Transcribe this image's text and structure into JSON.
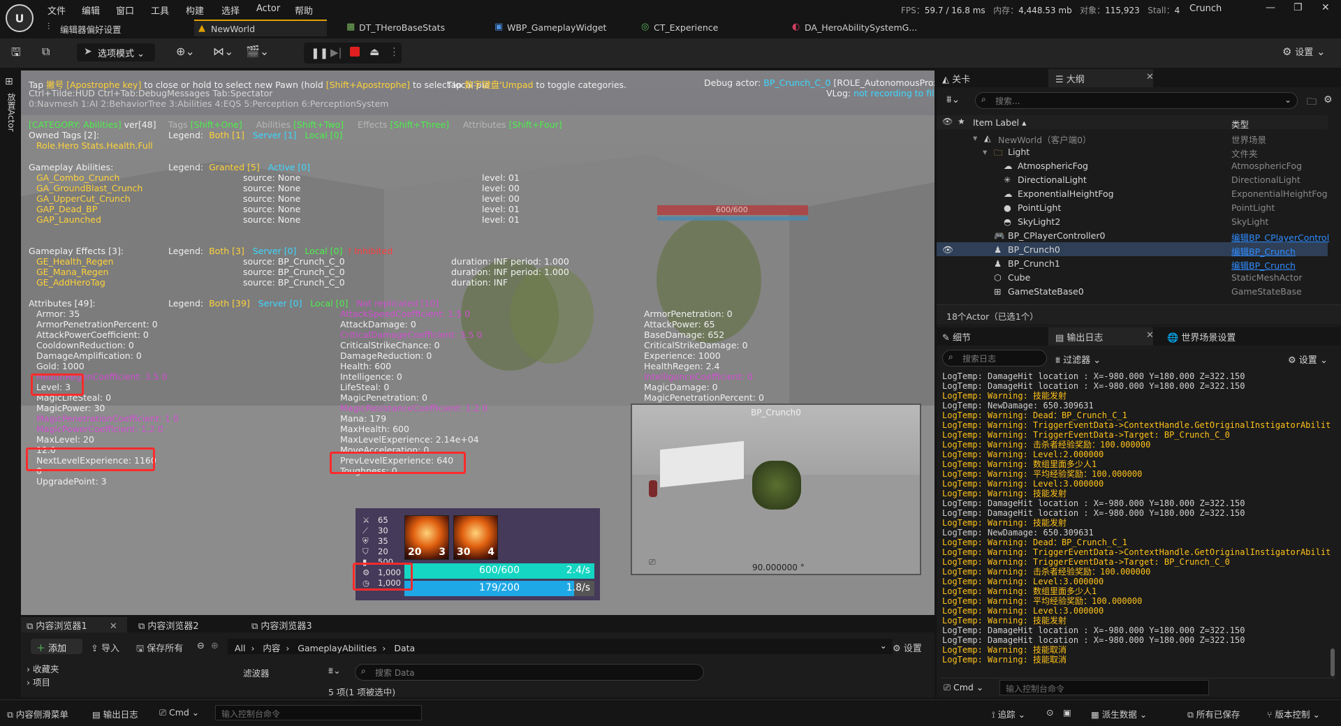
{
  "menu": {
    "items": [
      "文件",
      "编辑",
      "窗口",
      "工具",
      "构建",
      "选择",
      "Actor",
      "帮助"
    ],
    "stats": {
      "fps_label": "FPS：",
      "fps": "59.7",
      "ms": "/ 16.8 ms",
      "mem_label": "内存：",
      "mem": "4,448.53 mb",
      "obj_label": "对象：",
      "obj": "115,923",
      "stall_label": "Stall：",
      "stall": "4"
    },
    "project": "Crunch"
  },
  "tabs": [
    {
      "label": "编辑器偏好设置",
      "icon": "settings-sliders-icon"
    },
    {
      "label": "NewWorld",
      "icon": "level-icon"
    },
    {
      "label": "DT_THeroBaseStats",
      "icon": "datatable-icon"
    },
    {
      "label": "WBP_GameplayWidget",
      "icon": "widget-icon"
    },
    {
      "label": "CT_Experience",
      "icon": "curvetable-icon"
    },
    {
      "label": "DA_HeroAbilitySystemG...",
      "icon": "dataasset-icon"
    }
  ],
  "toolbar": {
    "mode_label": "选项模式",
    "settings_label": "设置"
  },
  "left_strip": {
    "label": "放置Actor"
  },
  "debug": {
    "line1_a": "Tap ",
    "line1_key": "撇号 [Apostrophe key]",
    "line1_b": " to close or hold to select new Pawn (hold ",
    "line1_key2": "[Shift+Apostrophe]",
    "line1_c": " to select local pla",
    "line1_d": "Tap ",
    "line1_key3": "数字键盘",
    "line1_e": "'Umpad",
    "line1_f": " to toggle categories.",
    "line2": "Ctrl+Tilde:HUD  Ctrl+Tab:DebugMessages  Tab:Spectator",
    "line3": "0:Navmesh  1:AI  2:BehaviorTree  3:Abilities  4:EQS  5:Perception  6:PerceptionSystem",
    "debug_actor_label": "Debug actor: ",
    "debug_actor": "BP_Crunch_C_0",
    "debug_role": " [ROLE_AutonomousProxy]",
    "vlog_label": "VLog: ",
    "vlog": "not recording to file",
    "category": "[CATEGORY: Abilities]",
    "ver": " ver[48]",
    "tags_label": "Tags ",
    "tags_key": "[Shift+One]",
    "abilities_label": "Abilities ",
    "abilities_key": "[Shift+Two]",
    "effects_label": "Effects ",
    "effects_key": "[Shift+Three]",
    "attributes_label": "Attributes ",
    "attributes_key": "[Shift+Four]",
    "owned_tags": "Owned Tags [2]:",
    "owned_tags_values": "Role.Hero Stats.Health.Full",
    "legend": "Legend:",
    "tags_legend_both": "Both [1]",
    "tags_legend_server": "Server [1]",
    "tags_legend_local": "Local [0]",
    "abilities_header": "Gameplay Abilities:",
    "abilities_legend_granted": "Granted [5]",
    "abilities_legend_active": "Active [0]",
    "abilities": [
      {
        "name": "GA_Combo_Crunch",
        "source": "source: None",
        "level": "level: 01"
      },
      {
        "name": "GA_GroundBlast_Crunch",
        "source": "source: None",
        "level": "level: 00"
      },
      {
        "name": "GA_UpperCut_Crunch",
        "source": "source: None",
        "level": "level: 00"
      },
      {
        "name": "GAP_Dead_BP",
        "source": "source: None",
        "level": "level: 01"
      },
      {
        "name": "GAP_Launched",
        "source": "source: None",
        "level": "level: 01"
      }
    ],
    "effects_header": "Gameplay Effects [3]:",
    "effects_legend_both": "Both [3]",
    "effects_legend_server": "Server [0]",
    "effects_legend_local": "Local [0]",
    "effects_legend_inhibited": "Inhibited",
    "effects": [
      {
        "name": "GE_Health_Regen",
        "source": "source: BP_Crunch_C_0",
        "duration": "duration: INF period: 1.000"
      },
      {
        "name": "GE_Mana_Regen",
        "source": "source: BP_Crunch_C_0",
        "duration": "duration: INF period: 1.000"
      },
      {
        "name": "GE_AddHeroTag",
        "source": "source: BP_Crunch_C_0",
        "duration": "duration: INF"
      }
    ],
    "attributes_header": "Attributes [49]:",
    "attr_legend_both": "Both [39]",
    "attr_legend_server": "Server [0]",
    "attr_legend_local": "Local [0]",
    "attr_legend_extra": "Not replicated [10]",
    "attr_col1": [
      {
        "t": "Armor: 35",
        "c": "w"
      },
      {
        "t": "ArmorPenetrationPercent: 0",
        "c": "w"
      },
      {
        "t": "AttackPowerCoefficient: 0",
        "c": "w"
      },
      {
        "t": "CooldownReduction: 0",
        "c": "w"
      },
      {
        "t": "DamageAmplification: 0",
        "c": "w"
      },
      {
        "t": "Gold: 1000",
        "c": "w"
      },
      {
        "t": "HealthRegenCoefficient: 3.5 0",
        "c": "m"
      },
      {
        "t": "Level: 3",
        "c": "w"
      },
      {
        "t": "MagicLifeSteal: 0",
        "c": "w"
      },
      {
        "t": "MagicPower: 30",
        "c": "w"
      },
      {
        "t": "MagicPenetrationCoefficient: 1 0",
        "c": "m"
      },
      {
        "t": "MagicPowerCoefficient: 1.2 0",
        "c": "m"
      },
      {
        "t": "MaxLevel: 20",
        "c": "w"
      },
      {
        "t": "12.0",
        "c": "w"
      },
      {
        "t": "NextLevelExperience: 1160",
        "c": "w"
      },
      {
        "t": "0",
        "c": "w"
      },
      {
        "t": "UpgradePoint: 3",
        "c": "w"
      }
    ],
    "attr_col2": [
      {
        "t": "AttackSpeedCoefficient: 1.5 0",
        "c": "m"
      },
      {
        "t": "AttackDamage: 0",
        "c": "w"
      },
      {
        "t": "CriticalDamageCoefficient: 3.5 0",
        "c": "m"
      },
      {
        "t": "CriticalStrikeChance: 0",
        "c": "w"
      },
      {
        "t": "DamageReduction: 0",
        "c": "w"
      },
      {
        "t": "Health: 600",
        "c": "w"
      },
      {
        "t": "Intelligence: 0",
        "c": "w"
      },
      {
        "t": "LifeSteal: 0",
        "c": "w"
      },
      {
        "t": "MagicPenetration: 0",
        "c": "w"
      },
      {
        "t": "MagicResistanceCoefficient: 1.2 0",
        "c": "m"
      },
      {
        "t": "Mana: 179",
        "c": "w"
      },
      {
        "t": "MaxHealth: 600",
        "c": "w"
      },
      {
        "t": "MaxLevelExperience: 2.14e+04",
        "c": "w"
      },
      {
        "t": "MoveAcceleration: 0",
        "c": "w"
      },
      {
        "t": "PrevLevelExperience: 640",
        "c": "w"
      },
      {
        "t": "Toughness: 0",
        "c": "w"
      }
    ],
    "attr_col3": [
      {
        "t": "ArmorPenetration: 0",
        "c": "w"
      },
      {
        "t": "AttackPower: 65",
        "c": "w"
      },
      {
        "t": "BaseDamage: 652",
        "c": "w"
      },
      {
        "t": "CriticalStrikeDamage: 0",
        "c": "w"
      },
      {
        "t": "Experience: 1000",
        "c": "w"
      },
      {
        "t": "HealthRegen: 2.4",
        "c": "w"
      },
      {
        "t": "IntelligenceCoefficient: 0",
        "c": "m"
      },
      {
        "t": "MagicDamage: 0",
        "c": "w"
      },
      {
        "t": "MagicPenetrationPercent: 0",
        "c": "w"
      }
    ],
    "enemy_health": "600/600"
  },
  "hud": {
    "stats": [
      "65",
      "30",
      "35",
      "20",
      "500",
      "1,000",
      "1,000"
    ],
    "skill1": {
      "level": "20",
      "count": "3"
    },
    "skill2": {
      "level": "30",
      "count": "4"
    },
    "health": {
      "text": "600/600",
      "regen": "2.4/s",
      "fraction": 1.0
    },
    "mana": {
      "text": "179/200",
      "regen": "1.8/s",
      "fraction": 0.895
    }
  },
  "preview": {
    "title": "BP_Crunch0",
    "angle": "90.000000 °"
  },
  "outliner": {
    "tabs": [
      "关卡",
      "大纲"
    ],
    "search_placeholder": "搜索...",
    "col_label": "Item Label ▴",
    "col_type": "类型",
    "rows": [
      {
        "label": "NewWorld（客户端0）",
        "type": "世界场景",
        "indent": 0,
        "icon": "level-icon",
        "link": false,
        "sel": false,
        "dim": true
      },
      {
        "label": "Light",
        "type": "文件夹",
        "indent": 1,
        "icon": "folder-icon",
        "link": false,
        "sel": false,
        "dim": false
      },
      {
        "label": "AtmosphericFog",
        "type": "AtmosphericFog",
        "indent": 2,
        "icon": "fog-icon",
        "link": false,
        "sel": false,
        "dim": false
      },
      {
        "label": "DirectionalLight",
        "type": "DirectionalLight",
        "indent": 2,
        "icon": "sun-icon",
        "link": false,
        "sel": false,
        "dim": false
      },
      {
        "label": "ExponentialHeightFog",
        "type": "ExponentialHeightFog",
        "indent": 2,
        "icon": "fog-icon",
        "link": false,
        "sel": false,
        "dim": false
      },
      {
        "label": "PointLight",
        "type": "PointLight",
        "indent": 2,
        "icon": "bulb-icon",
        "link": false,
        "sel": false,
        "dim": false
      },
      {
        "label": "SkyLight2",
        "type": "SkyLight",
        "indent": 2,
        "icon": "skylight-icon",
        "link": false,
        "sel": false,
        "dim": false
      },
      {
        "label": "BP_CPlayerController0",
        "type": "编辑BP_CPlayerControl",
        "indent": 1,
        "icon": "gamepad-icon",
        "link": true,
        "sel": false,
        "dim": false
      },
      {
        "label": "BP_Crunch0",
        "type": "编辑BP_Crunch",
        "indent": 1,
        "icon": "pawn-icon",
        "link": true,
        "sel": true,
        "dim": false
      },
      {
        "label": "BP_Crunch1",
        "type": "编辑BP_Crunch",
        "indent": 1,
        "icon": "pawn-icon",
        "link": true,
        "sel": false,
        "dim": false
      },
      {
        "label": "Cube",
        "type": "StaticMeshActor",
        "indent": 1,
        "icon": "cube-icon",
        "link": false,
        "sel": false,
        "dim": false
      },
      {
        "label": "GameStateBase0",
        "type": "GameStateBase",
        "indent": 1,
        "icon": "gamestate-icon",
        "link": false,
        "sel": false,
        "dim": false
      }
    ],
    "footer": "18个Actor（已选1个）"
  },
  "lower_right": {
    "tabs": [
      "细节",
      "输出日志",
      "世界场景设置"
    ],
    "search_placeholder": "搜索日志",
    "filter_label": "过滤器",
    "settings_label": "设置",
    "cmd_label": "Cmd",
    "console_placeholder": "输入控制台命令"
  },
  "log": [
    {
      "t": "LogTemp: DamageHit location : X=-980.000 Y=180.000 Z=322.150",
      "warn": false
    },
    {
      "t": "LogTemp: DamageHit location : X=-980.000 Y=180.000 Z=322.150",
      "warn": false
    },
    {
      "t": "LogTemp: Warning: 技能发射",
      "warn": true
    },
    {
      "t": "LogTemp: NewDamage: 650.309631",
      "warn": false
    },
    {
      "t": "LogTemp: Warning: Dead：BP_Crunch_C_1",
      "warn": true
    },
    {
      "t": "LogTemp: Warning: TriggerEventData->ContextHandle.GetOriginalInstigatorAbilit",
      "warn": true
    },
    {
      "t": "LogTemp: Warning: TriggerEventData->Target: BP_Crunch_C_0",
      "warn": true
    },
    {
      "t": "LogTemp: Warning: 击杀者经验奖励：100.000000",
      "warn": true
    },
    {
      "t": "LogTemp: Warning: Level:2.000000",
      "warn": true
    },
    {
      "t": "LogTemp: Warning: 数组里面多少人1",
      "warn": true
    },
    {
      "t": "LogTemp: Warning: 平均经验奖励：100.000000",
      "warn": true
    },
    {
      "t": "LogTemp: Warning: Level:3.000000",
      "warn": true
    },
    {
      "t": "LogTemp: Warning: 技能发射",
      "warn": true
    },
    {
      "t": "LogTemp: DamageHit location : X=-980.000 Y=180.000 Z=322.150",
      "warn": false
    },
    {
      "t": "LogTemp: DamageHit location : X=-980.000 Y=180.000 Z=322.150",
      "warn": false
    },
    {
      "t": "LogTemp: Warning: 技能发射",
      "warn": true
    },
    {
      "t": "LogTemp: NewDamage: 650.309631",
      "warn": false
    },
    {
      "t": "LogTemp: Warning: Dead：BP_Crunch_C_1",
      "warn": true
    },
    {
      "t": "LogTemp: Warning: TriggerEventData->ContextHandle.GetOriginalInstigatorAbilit",
      "warn": true
    },
    {
      "t": "LogTemp: Warning: TriggerEventData->Target: BP_Crunch_C_0",
      "warn": true
    },
    {
      "t": "LogTemp: Warning: 击杀者经验奖励：100.000000",
      "warn": true
    },
    {
      "t": "LogTemp: Warning: Level:3.000000",
      "warn": true
    },
    {
      "t": "LogTemp: Warning: 数组里面多少人1",
      "warn": true
    },
    {
      "t": "LogTemp: Warning: 平均经验奖励：100.000000",
      "warn": true
    },
    {
      "t": "LogTemp: Warning: Level:3.000000",
      "warn": true
    },
    {
      "t": "LogTemp: Warning: 技能发射",
      "warn": true
    },
    {
      "t": "LogTemp: DamageHit location : X=-980.000 Y=180.000 Z=322.150",
      "warn": false
    },
    {
      "t": "LogTemp: DamageHit location : X=-980.000 Y=180.000 Z=322.150",
      "warn": false
    },
    {
      "t": "LogTemp: Warning: 技能取消",
      "warn": true
    },
    {
      "t": "LogTemp: Warning: 技能取消",
      "warn": true
    }
  ],
  "content_browser": {
    "tabs": [
      "内容浏览器1",
      "内容浏览器2",
      "内容浏览器3"
    ],
    "add_label": "添加",
    "import_label": "导入",
    "save_all_label": "保存所有",
    "path": [
      "All",
      "内容",
      "GameplayAbilities",
      "Data"
    ],
    "settings_label": "设置",
    "favorites": "收藏夹",
    "project_tree": "项目",
    "filter_label": "滤波器",
    "search_placeholder": "搜索 Data",
    "item_count": "5 项(1 项被选中)"
  },
  "statusbar": {
    "content_drawer": "内容侧滑菜单",
    "output_log": "输出日志",
    "cmd": "Cmd",
    "console_placeholder": "输入控制台命令",
    "trace": "追踪",
    "derived_data": "派生数据",
    "all_saved": "所有已保存",
    "source_control": "版本控制"
  }
}
